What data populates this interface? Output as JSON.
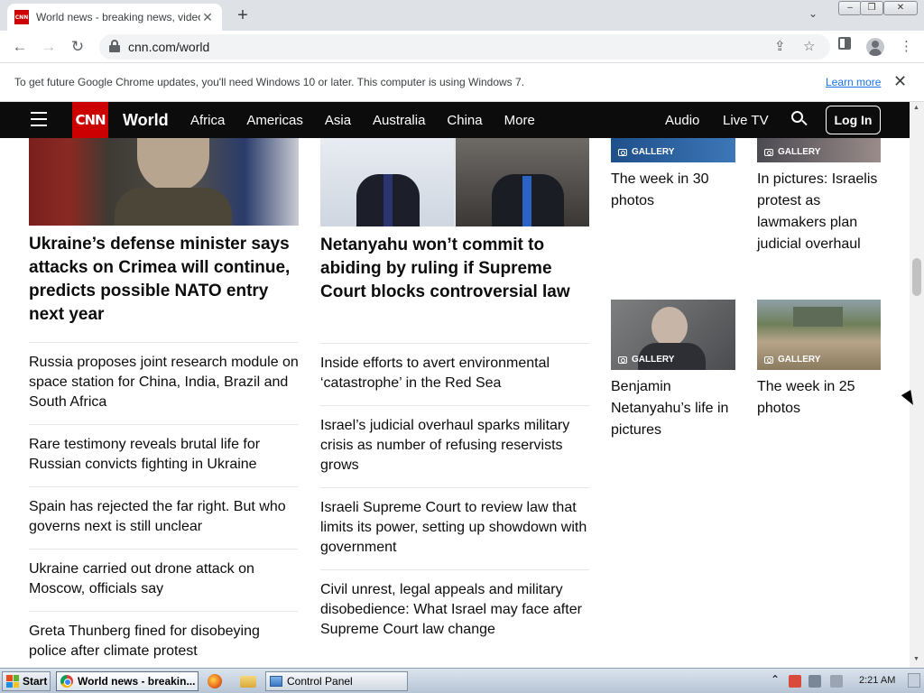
{
  "browser": {
    "tab_title": "World news - breaking news, video, headlines",
    "tab_favicon_text": "CNN",
    "url": "cnn.com/world",
    "info_message": "To get future Google Chrome updates, you'll need Windows 10 or later. This computer is using Windows 7.",
    "learn_more": "Learn more"
  },
  "cnn_nav": {
    "logo": "CNN",
    "section": "World",
    "links": [
      "Africa",
      "Americas",
      "Asia",
      "Australia",
      "China",
      "More"
    ],
    "audio": "Audio",
    "live_tv": "Live TV",
    "login": "Log In"
  },
  "left_column": {
    "headline": "Ukraine’s defense minister says attacks on Crimea will continue, predicts possible NATO entry next year",
    "stories": [
      "Russia proposes joint research module on space station for China, India, Brazil and South Africa",
      "Rare testimony reveals brutal life for Russian convicts fighting in Ukraine",
      "Spain has rejected the far right. But who governs next is still unclear",
      "Ukraine carried out drone attack on Moscow, officials say",
      "Greta Thunberg fined for disobeying police after climate protest"
    ]
  },
  "middle_column": {
    "headline": "Netanyahu won’t commit to abiding by ruling if Supreme Court blocks controversial law",
    "stories": [
      "Inside efforts to avert environmental ‘catastrophe’ in the Red Sea",
      "Israel’s judicial overhaul sparks military crisis as number of refusing reservists grows",
      "Israeli Supreme Court to review law that limits its power, setting up showdown with government",
      "Civil unrest, legal appeals and military disobedience: What Israel may face after Supreme Court law change"
    ]
  },
  "galleries": {
    "tag": "GALLERY",
    "items": [
      "The week in 30 photos",
      "In pictures: Israelis protest as lawmakers plan judicial overhaul",
      "Benjamin Netanyahu’s life in pictures",
      "The week in 25 photos"
    ]
  },
  "taskbar": {
    "start": "Start",
    "items": [
      "World news - breakin...",
      "Control Panel"
    ],
    "clock": "2:21 AM"
  },
  "colors": {
    "cnn_red": "#cc0000",
    "nav_black": "#0c0c0c",
    "link_blue": "#1a73e8"
  }
}
